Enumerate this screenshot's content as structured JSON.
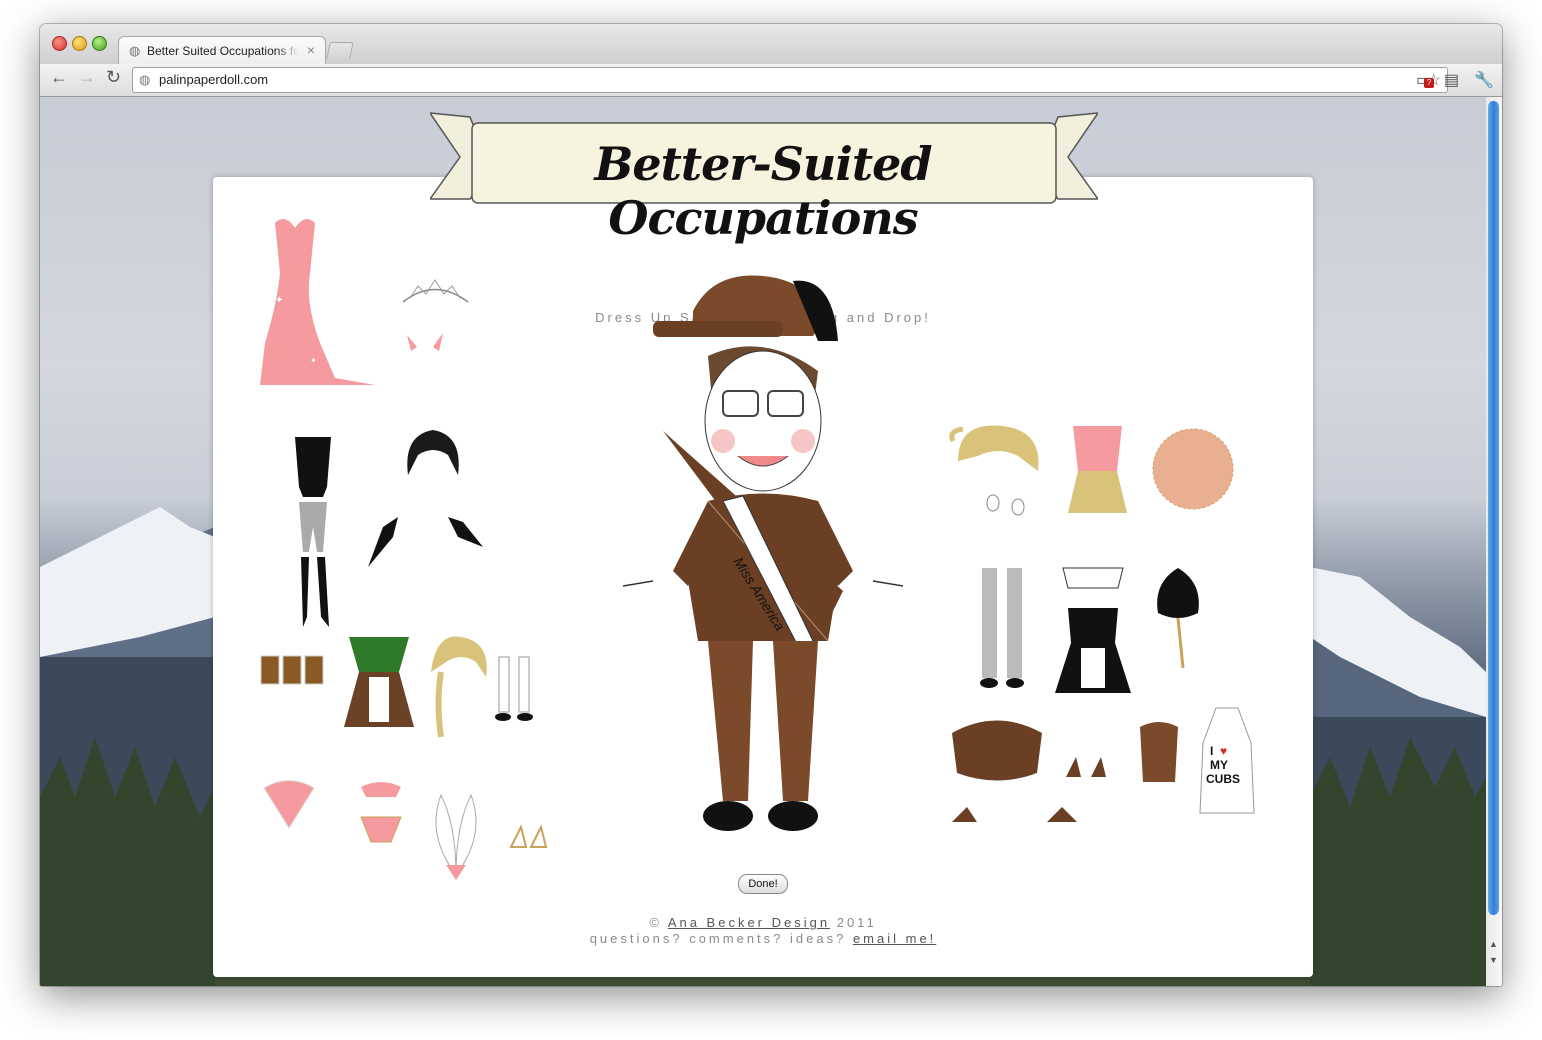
{
  "browser": {
    "tab_title": "Better Suited Occupations fo",
    "url": "palinpaperdoll.com"
  },
  "page": {
    "banner_title": "Better-Suited Occupations",
    "subtitle": "Dress Up Sarah Palin : Drag and Drop!",
    "done_label": "Done!",
    "sash_text": "Miss America",
    "apron_text_line1": "I",
    "apron_text_line2": "MY",
    "apron_text_line3": "CUBS",
    "footer": {
      "copyright_symbol": "©",
      "designer_link": "Ana Becker Design",
      "year": "2011",
      "questions_text": "questions? comments? ideas?",
      "email_link": "email me!"
    }
  },
  "colors": {
    "pink": "#f59a9e",
    "brown": "#7a4a2a",
    "blonde": "#d9c27a",
    "scrollbar": "#2f7fd6"
  }
}
